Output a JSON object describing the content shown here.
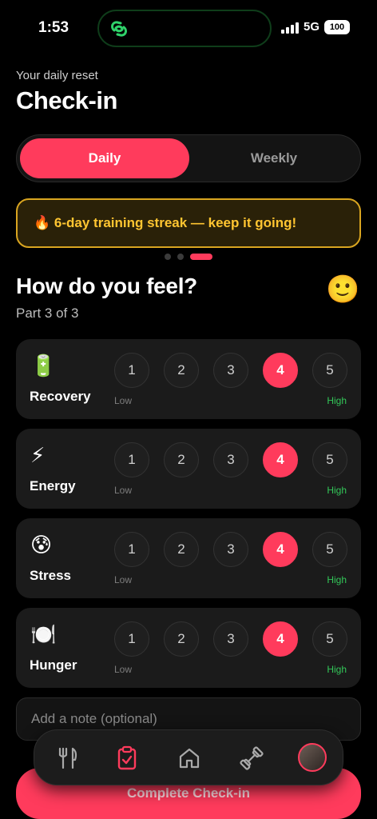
{
  "status_bar": {
    "time": "1:53",
    "network": "5G",
    "battery": "100"
  },
  "header": {
    "subtitle": "Your daily reset",
    "title": "Check-in"
  },
  "segment": {
    "daily": "Daily",
    "weekly": "Weekly",
    "selected": "Daily"
  },
  "banner": {
    "emoji": "🔥",
    "text": "6-day training streak — keep it going!"
  },
  "pager": {
    "count": 3,
    "active_index": 2
  },
  "section": {
    "title": "How do you feel?",
    "emoji": "🙂",
    "part": "Part 3 of 3"
  },
  "scale": {
    "low_label": "Low",
    "high_label": "High",
    "options": [
      "1",
      "2",
      "3",
      "4",
      "5"
    ]
  },
  "ratings": [
    {
      "icon": "🔋",
      "label": "Recovery",
      "value": 4
    },
    {
      "icon": "⚡",
      "label": "Energy",
      "value": 4
    },
    {
      "icon": "😰",
      "label": "Stress",
      "value": 4
    },
    {
      "icon": "🍽️",
      "label": "Hunger",
      "value": 4
    }
  ],
  "note": {
    "placeholder": "Add a note (optional)"
  },
  "cta": {
    "label": "Complete Check-in"
  },
  "tabbar": {
    "items": [
      "fork-knife-icon",
      "clipboard-check-icon",
      "home-icon",
      "dumbbell-icon",
      "avatar"
    ],
    "active": 1
  },
  "colors": {
    "accent": "#ff3b5c",
    "banner_text": "#ffc531",
    "banner_border": "#d9a520",
    "high": "#33c759",
    "background": "#000000"
  }
}
